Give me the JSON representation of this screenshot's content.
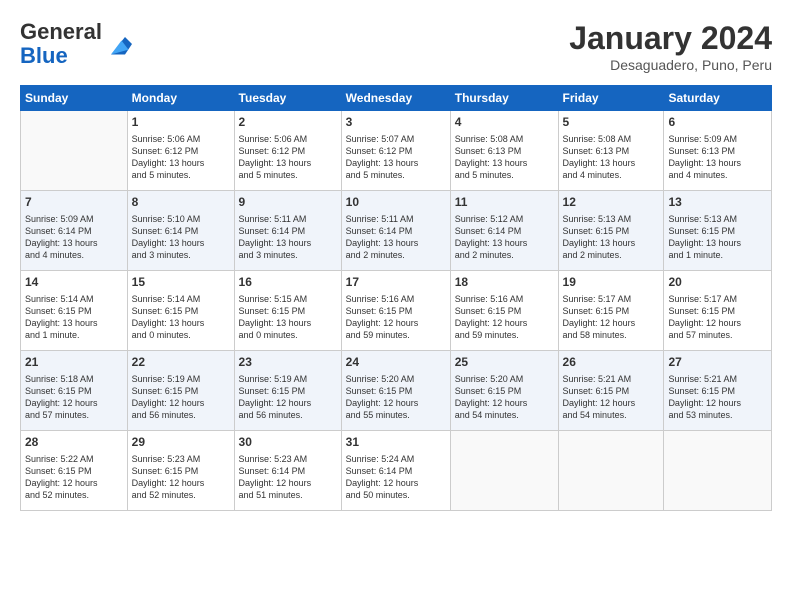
{
  "logo": {
    "general": "General",
    "blue": "Blue"
  },
  "header": {
    "month": "January 2024",
    "location": "Desaguadero, Puno, Peru"
  },
  "weekdays": [
    "Sunday",
    "Monday",
    "Tuesday",
    "Wednesday",
    "Thursday",
    "Friday",
    "Saturday"
  ],
  "weeks": [
    [
      {
        "day": "",
        "info": ""
      },
      {
        "day": "1",
        "info": "Sunrise: 5:06 AM\nSunset: 6:12 PM\nDaylight: 13 hours\nand 5 minutes."
      },
      {
        "day": "2",
        "info": "Sunrise: 5:06 AM\nSunset: 6:12 PM\nDaylight: 13 hours\nand 5 minutes."
      },
      {
        "day": "3",
        "info": "Sunrise: 5:07 AM\nSunset: 6:12 PM\nDaylight: 13 hours\nand 5 minutes."
      },
      {
        "day": "4",
        "info": "Sunrise: 5:08 AM\nSunset: 6:13 PM\nDaylight: 13 hours\nand 5 minutes."
      },
      {
        "day": "5",
        "info": "Sunrise: 5:08 AM\nSunset: 6:13 PM\nDaylight: 13 hours\nand 4 minutes."
      },
      {
        "day": "6",
        "info": "Sunrise: 5:09 AM\nSunset: 6:13 PM\nDaylight: 13 hours\nand 4 minutes."
      }
    ],
    [
      {
        "day": "7",
        "info": "Sunrise: 5:09 AM\nSunset: 6:14 PM\nDaylight: 13 hours\nand 4 minutes."
      },
      {
        "day": "8",
        "info": "Sunrise: 5:10 AM\nSunset: 6:14 PM\nDaylight: 13 hours\nand 3 minutes."
      },
      {
        "day": "9",
        "info": "Sunrise: 5:11 AM\nSunset: 6:14 PM\nDaylight: 13 hours\nand 3 minutes."
      },
      {
        "day": "10",
        "info": "Sunrise: 5:11 AM\nSunset: 6:14 PM\nDaylight: 13 hours\nand 2 minutes."
      },
      {
        "day": "11",
        "info": "Sunrise: 5:12 AM\nSunset: 6:14 PM\nDaylight: 13 hours\nand 2 minutes."
      },
      {
        "day": "12",
        "info": "Sunrise: 5:13 AM\nSunset: 6:15 PM\nDaylight: 13 hours\nand 2 minutes."
      },
      {
        "day": "13",
        "info": "Sunrise: 5:13 AM\nSunset: 6:15 PM\nDaylight: 13 hours\nand 1 minute."
      }
    ],
    [
      {
        "day": "14",
        "info": "Sunrise: 5:14 AM\nSunset: 6:15 PM\nDaylight: 13 hours\nand 1 minute."
      },
      {
        "day": "15",
        "info": "Sunrise: 5:14 AM\nSunset: 6:15 PM\nDaylight: 13 hours\nand 0 minutes."
      },
      {
        "day": "16",
        "info": "Sunrise: 5:15 AM\nSunset: 6:15 PM\nDaylight: 13 hours\nand 0 minutes."
      },
      {
        "day": "17",
        "info": "Sunrise: 5:16 AM\nSunset: 6:15 PM\nDaylight: 12 hours\nand 59 minutes."
      },
      {
        "day": "18",
        "info": "Sunrise: 5:16 AM\nSunset: 6:15 PM\nDaylight: 12 hours\nand 59 minutes."
      },
      {
        "day": "19",
        "info": "Sunrise: 5:17 AM\nSunset: 6:15 PM\nDaylight: 12 hours\nand 58 minutes."
      },
      {
        "day": "20",
        "info": "Sunrise: 5:17 AM\nSunset: 6:15 PM\nDaylight: 12 hours\nand 57 minutes."
      }
    ],
    [
      {
        "day": "21",
        "info": "Sunrise: 5:18 AM\nSunset: 6:15 PM\nDaylight: 12 hours\nand 57 minutes."
      },
      {
        "day": "22",
        "info": "Sunrise: 5:19 AM\nSunset: 6:15 PM\nDaylight: 12 hours\nand 56 minutes."
      },
      {
        "day": "23",
        "info": "Sunrise: 5:19 AM\nSunset: 6:15 PM\nDaylight: 12 hours\nand 56 minutes."
      },
      {
        "day": "24",
        "info": "Sunrise: 5:20 AM\nSunset: 6:15 PM\nDaylight: 12 hours\nand 55 minutes."
      },
      {
        "day": "25",
        "info": "Sunrise: 5:20 AM\nSunset: 6:15 PM\nDaylight: 12 hours\nand 54 minutes."
      },
      {
        "day": "26",
        "info": "Sunrise: 5:21 AM\nSunset: 6:15 PM\nDaylight: 12 hours\nand 54 minutes."
      },
      {
        "day": "27",
        "info": "Sunrise: 5:21 AM\nSunset: 6:15 PM\nDaylight: 12 hours\nand 53 minutes."
      }
    ],
    [
      {
        "day": "28",
        "info": "Sunrise: 5:22 AM\nSunset: 6:15 PM\nDaylight: 12 hours\nand 52 minutes."
      },
      {
        "day": "29",
        "info": "Sunrise: 5:23 AM\nSunset: 6:15 PM\nDaylight: 12 hours\nand 52 minutes."
      },
      {
        "day": "30",
        "info": "Sunrise: 5:23 AM\nSunset: 6:14 PM\nDaylight: 12 hours\nand 51 minutes."
      },
      {
        "day": "31",
        "info": "Sunrise: 5:24 AM\nSunset: 6:14 PM\nDaylight: 12 hours\nand 50 minutes."
      },
      {
        "day": "",
        "info": ""
      },
      {
        "day": "",
        "info": ""
      },
      {
        "day": "",
        "info": ""
      }
    ]
  ]
}
